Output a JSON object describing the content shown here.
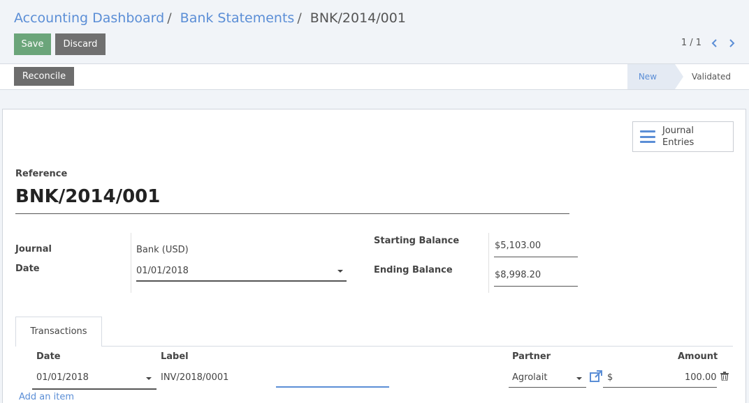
{
  "breadcrumb": {
    "items": [
      "Accounting Dashboard",
      "Bank Statements"
    ],
    "current": "BNK/2014/001",
    "separator": "/"
  },
  "toolbar": {
    "save_label": "Save",
    "discard_label": "Discard"
  },
  "pager": {
    "value": "1 / 1",
    "prev_icon": "chevron-left-icon",
    "next_icon": "chevron-right-icon"
  },
  "statusbar": {
    "reconcile_label": "Reconcile",
    "stages": [
      "New",
      "Validated"
    ],
    "active_stage": "New"
  },
  "smart_button": {
    "line1": "Journal",
    "line2": "Entries",
    "icon": "list-icon"
  },
  "form": {
    "reference_label": "Reference",
    "reference_value": "BNK/2014/001",
    "journal_label": "Journal",
    "journal_value": "Bank (USD)",
    "date_label": "Date",
    "date_value": "01/01/2018",
    "starting_balance_label": "Starting Balance",
    "starting_balance_value": "$5,103.00",
    "ending_balance_label": "Ending Balance",
    "ending_balance_value": "$8,998.20"
  },
  "tabs": {
    "transactions_label": "Transactions"
  },
  "lines": {
    "headers": {
      "date": "Date",
      "label": "Label",
      "partner": "Partner",
      "amount": "Amount"
    },
    "rows": [
      {
        "date": "01/01/2018",
        "label": "INV/2018/0001",
        "partner": "Agrolait",
        "currency": "$",
        "amount": "100.00"
      }
    ],
    "add_item_label": "Add an item"
  },
  "colors": {
    "accent": "#5b8ed6",
    "save": "#6ba57a",
    "secondary_button": "#707070",
    "panel_background": "#f1f4f8"
  }
}
